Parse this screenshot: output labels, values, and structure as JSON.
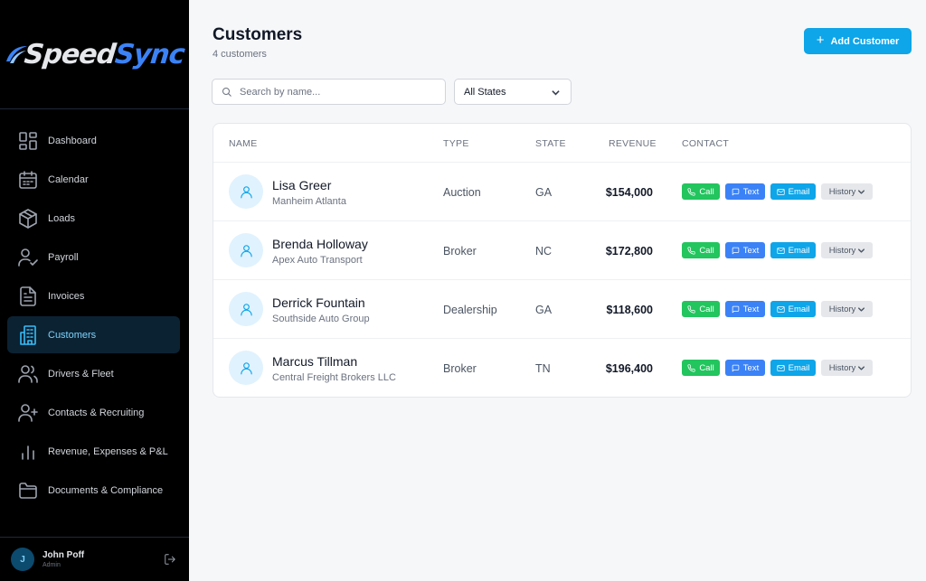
{
  "brand": {
    "name_part1": "Speed",
    "name_part2": "Sync",
    "accent": "#3b82f6"
  },
  "sidebar": {
    "items": [
      {
        "label": "Dashboard",
        "icon": "dashboard-icon"
      },
      {
        "label": "Calendar",
        "icon": "calendar-icon"
      },
      {
        "label": "Loads",
        "icon": "box-icon"
      },
      {
        "label": "Payroll",
        "icon": "user-check-icon"
      },
      {
        "label": "Invoices",
        "icon": "invoice-icon"
      },
      {
        "label": "Customers",
        "icon": "building-icon",
        "active": true
      },
      {
        "label": "Drivers & Fleet",
        "icon": "users-icon"
      },
      {
        "label": "Contacts & Recruiting",
        "icon": "user-plus-icon"
      },
      {
        "label": "Revenue, Expenses & P&L",
        "icon": "bar-chart-icon"
      },
      {
        "label": "Documents & Compliance",
        "icon": "folder-icon"
      }
    ],
    "user": {
      "initial": "J",
      "name": "John Poff",
      "role": "Admin"
    }
  },
  "header": {
    "title": "Customers",
    "subtitle": "4 customers",
    "add_button_label": "Add Customer"
  },
  "filters": {
    "search_placeholder": "Search by name...",
    "state_selected": "All States"
  },
  "table": {
    "columns": [
      "NAME",
      "TYPE",
      "STATE",
      "REVENUE",
      "CONTACT"
    ],
    "action_labels": {
      "call": "Call",
      "text": "Text",
      "email": "Email",
      "history": "History"
    },
    "rows": [
      {
        "name": "Lisa Greer",
        "company": "Manheim Atlanta",
        "type": "Auction",
        "state": "GA",
        "revenue": "$154,000"
      },
      {
        "name": "Brenda Holloway",
        "company": "Apex Auto Transport",
        "type": "Broker",
        "state": "NC",
        "revenue": "$172,800"
      },
      {
        "name": "Derrick Fountain",
        "company": "Southside Auto Group",
        "type": "Dealership",
        "state": "GA",
        "revenue": "$118,600"
      },
      {
        "name": "Marcus Tillman",
        "company": "Central Freight Brokers LLC",
        "type": "Broker",
        "state": "TN",
        "revenue": "$196,400"
      }
    ]
  },
  "colors": {
    "primary": "#0ea5e9",
    "call": "#22c55e",
    "text": "#3b82f6",
    "email": "#0ea5e9",
    "history": "#e5e7eb"
  }
}
